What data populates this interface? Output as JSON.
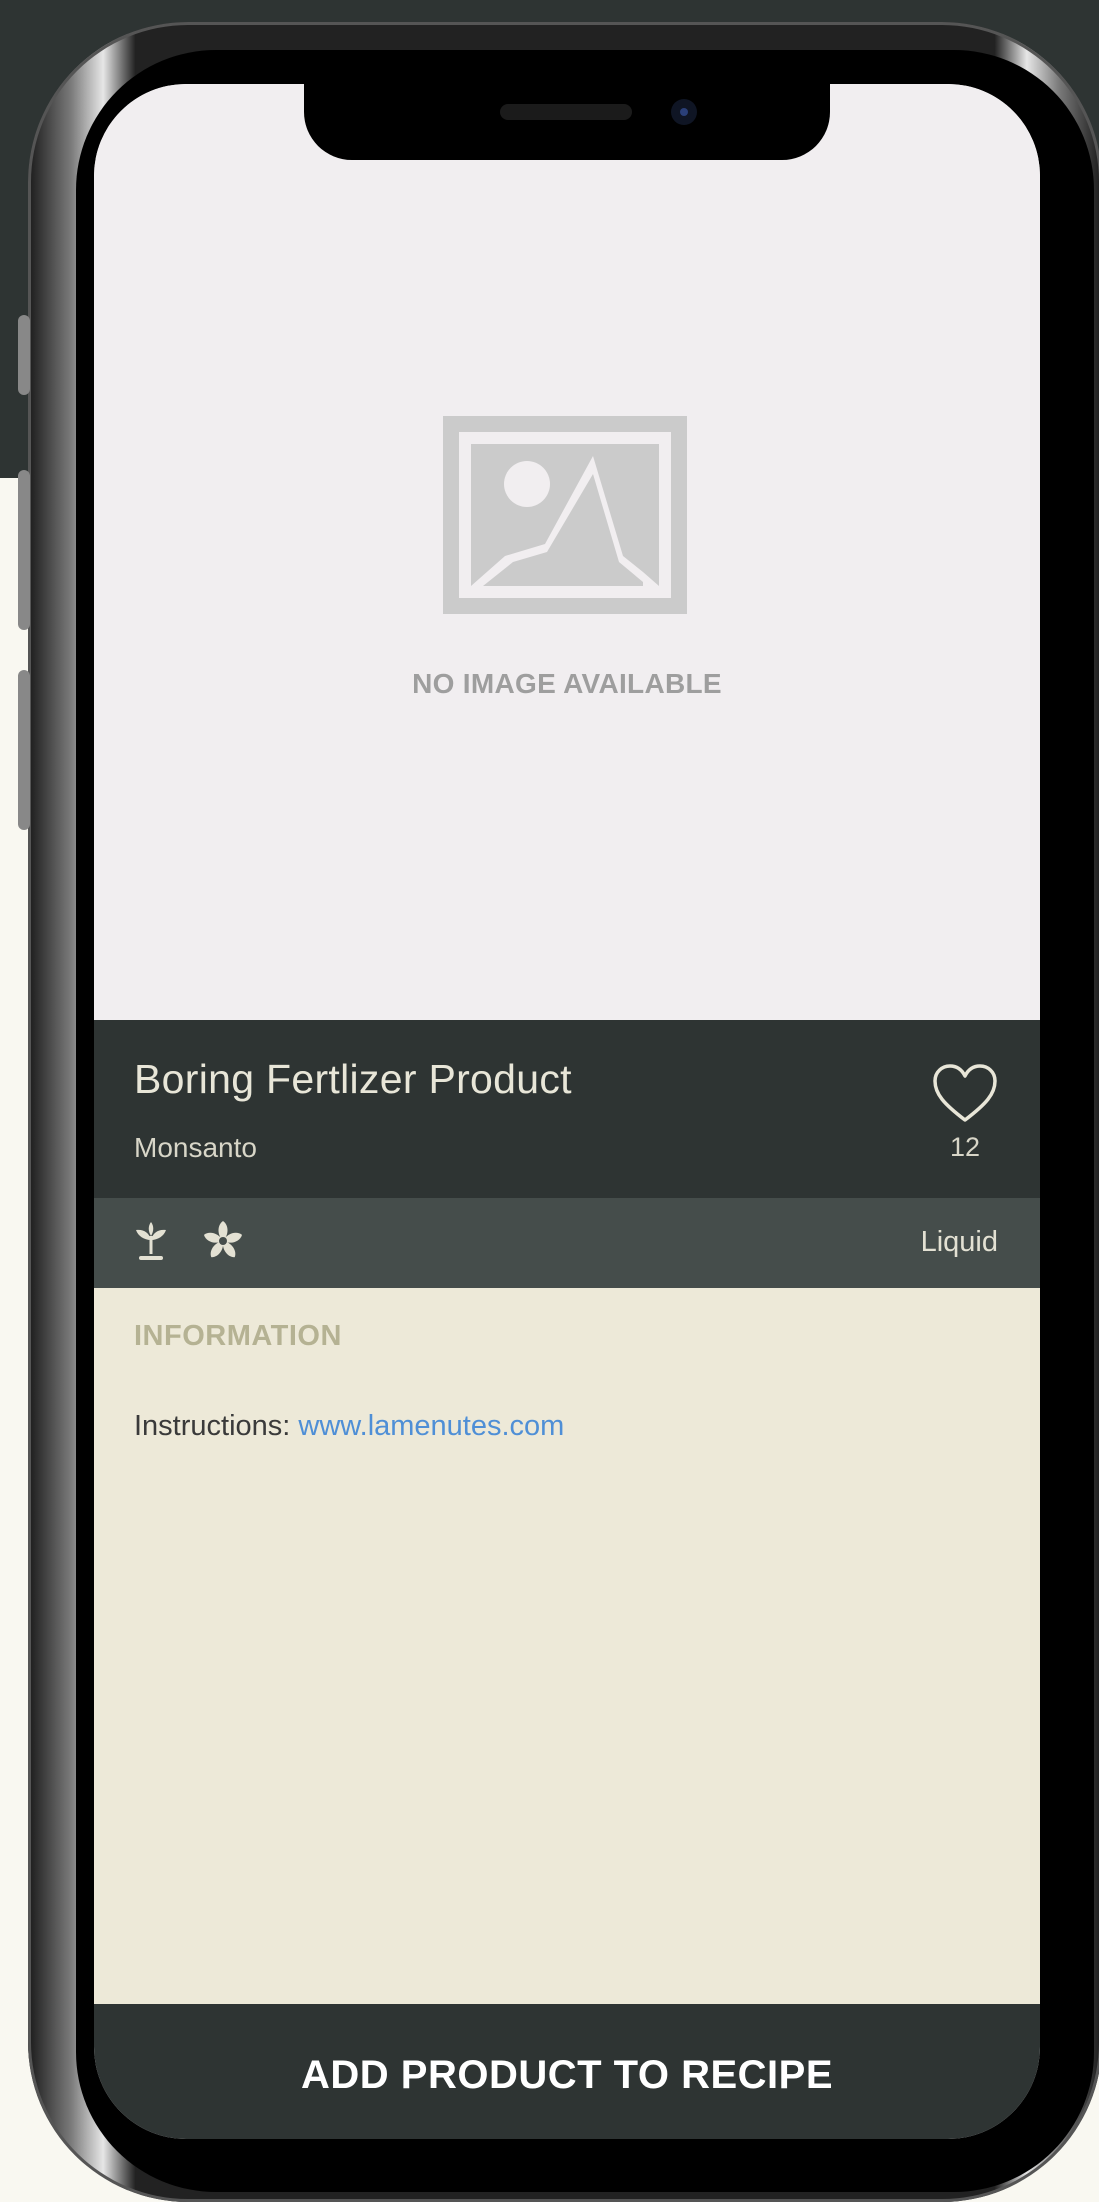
{
  "image_placeholder": {
    "text": "NO IMAGE AVAILABLE",
    "icon": "image-placeholder-icon"
  },
  "product": {
    "name": "Boring Fertlizer Product",
    "brand": "Monsanto",
    "likes": "12",
    "favorite_icon": "heart-outline-icon"
  },
  "attributes": {
    "icons": [
      "plant-sprout-icon",
      "flower-icon"
    ],
    "form": "Liquid"
  },
  "information": {
    "heading": "INFORMATION",
    "instructions_label": "Instructions:",
    "instructions_link": "www.lamenutes.com"
  },
  "actions": {
    "add_to_recipe": "ADD PRODUCT TO RECIPE"
  },
  "colors": {
    "dark_header": "#2e3433",
    "attribute_bar": "#454d4b",
    "info_background": "#ede9d8",
    "link": "#4f8fd6",
    "heading_muted": "#b5b293"
  }
}
